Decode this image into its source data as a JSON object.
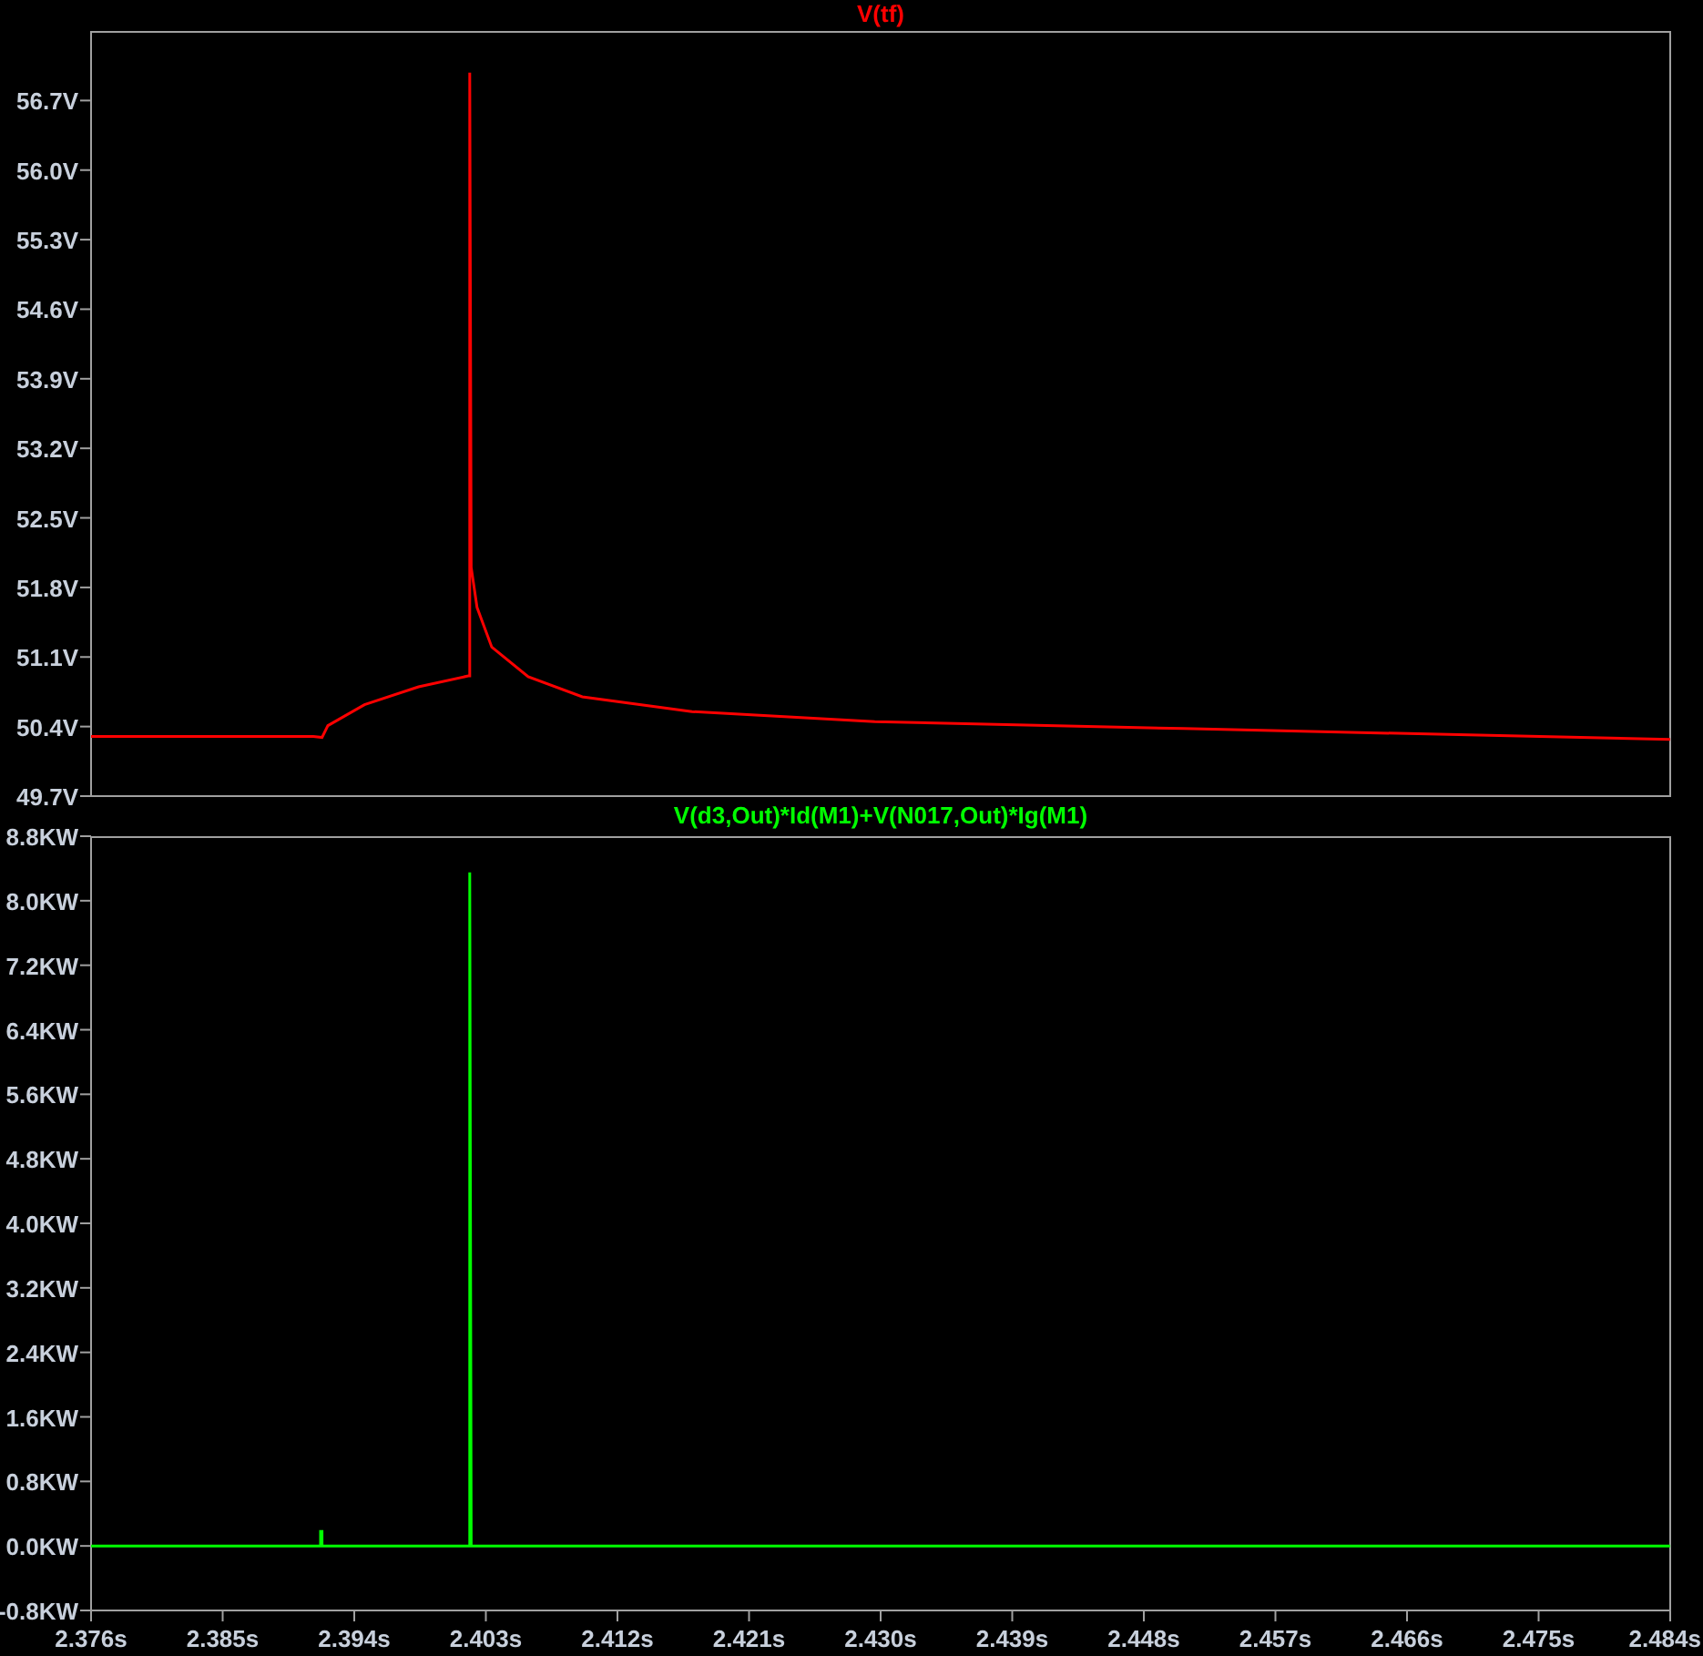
{
  "panes": [
    {
      "chart_data": {
        "type": "line",
        "title": "V(tf)",
        "xlim": [
          2.376,
          2.484
        ],
        "ylim": [
          49.7,
          57.4
        ],
        "yticks": [
          {
            "value": 49.7,
            "label": "49.7V"
          },
          {
            "value": 50.4,
            "label": "50.4V"
          },
          {
            "value": 51.1,
            "label": "51.1V"
          },
          {
            "value": 51.8,
            "label": "51.8V"
          },
          {
            "value": 52.5,
            "label": "52.5V"
          },
          {
            "value": 53.2,
            "label": "53.2V"
          },
          {
            "value": 53.9,
            "label": "53.9V"
          },
          {
            "value": 54.6,
            "label": "54.6V"
          },
          {
            "value": 55.3,
            "label": "55.3V"
          },
          {
            "value": 56.0,
            "label": "56.0V"
          },
          {
            "value": 56.7,
            "label": "56.7V"
          }
        ],
        "x": [
          2.376,
          2.3912,
          2.3918,
          2.3922,
          2.3947,
          2.3984,
          2.4018,
          2.4019,
          2.4019,
          2.402,
          2.4024,
          2.4034,
          2.4059,
          2.4096,
          2.4171,
          2.4296,
          2.4507,
          2.484
        ],
        "series": [
          {
            "color": "#ff0000",
            "values": [
              50.3,
              50.3,
              50.29,
              50.41,
              50.62,
              50.8,
              50.91,
              50.91,
              56.98,
              52.0,
              51.6,
              51.2,
              50.9,
              50.7,
              50.55,
              50.45,
              50.38,
              50.27
            ]
          }
        ]
      }
    },
    {
      "chart_data": {
        "type": "line",
        "title": "V(d3,Out)*Id(M1)+V(N017,Out)*Ig(M1)",
        "xlim": [
          2.376,
          2.484
        ],
        "ylim": [
          -0.8,
          8.8
        ],
        "xticks": [
          {
            "value": 2.376,
            "label": "2.376s"
          },
          {
            "value": 2.385,
            "label": "2.385s"
          },
          {
            "value": 2.394,
            "label": "2.394s"
          },
          {
            "value": 2.403,
            "label": "2.403s"
          },
          {
            "value": 2.412,
            "label": "2.412s"
          },
          {
            "value": 2.421,
            "label": "2.421s"
          },
          {
            "value": 2.43,
            "label": "2.430s"
          },
          {
            "value": 2.439,
            "label": "2.439s"
          },
          {
            "value": 2.448,
            "label": "2.448s"
          },
          {
            "value": 2.457,
            "label": "2.457s"
          },
          {
            "value": 2.466,
            "label": "2.466s"
          },
          {
            "value": 2.475,
            "label": "2.475s"
          },
          {
            "value": 2.484,
            "label": "2.484s"
          }
        ],
        "yticks": [
          {
            "value": -0.8,
            "label": "-0.8KW"
          },
          {
            "value": 0.0,
            "label": "0.0KW"
          },
          {
            "value": 0.8,
            "label": "0.8KW"
          },
          {
            "value": 1.6,
            "label": "1.6KW"
          },
          {
            "value": 2.4,
            "label": "2.4KW"
          },
          {
            "value": 3.2,
            "label": "3.2KW"
          },
          {
            "value": 4.0,
            "label": "4.0KW"
          },
          {
            "value": 4.8,
            "label": "4.8KW"
          },
          {
            "value": 5.6,
            "label": "5.6KW"
          },
          {
            "value": 6.4,
            "label": "6.4KW"
          },
          {
            "value": 7.2,
            "label": "7.2KW"
          },
          {
            "value": 8.0,
            "label": "8.0KW"
          },
          {
            "value": 8.8,
            "label": "8.8KW"
          }
        ],
        "x": [
          2.376,
          2.3917,
          2.3917,
          2.3918,
          2.3918,
          2.4018,
          2.4019,
          2.4019,
          2.402,
          2.484
        ],
        "series": [
          {
            "color": "#00ff00",
            "values": [
              0,
              0,
              0.18,
              0.18,
              0,
              0,
              0,
              8.35,
              0,
              0
            ]
          }
        ]
      }
    }
  ]
}
